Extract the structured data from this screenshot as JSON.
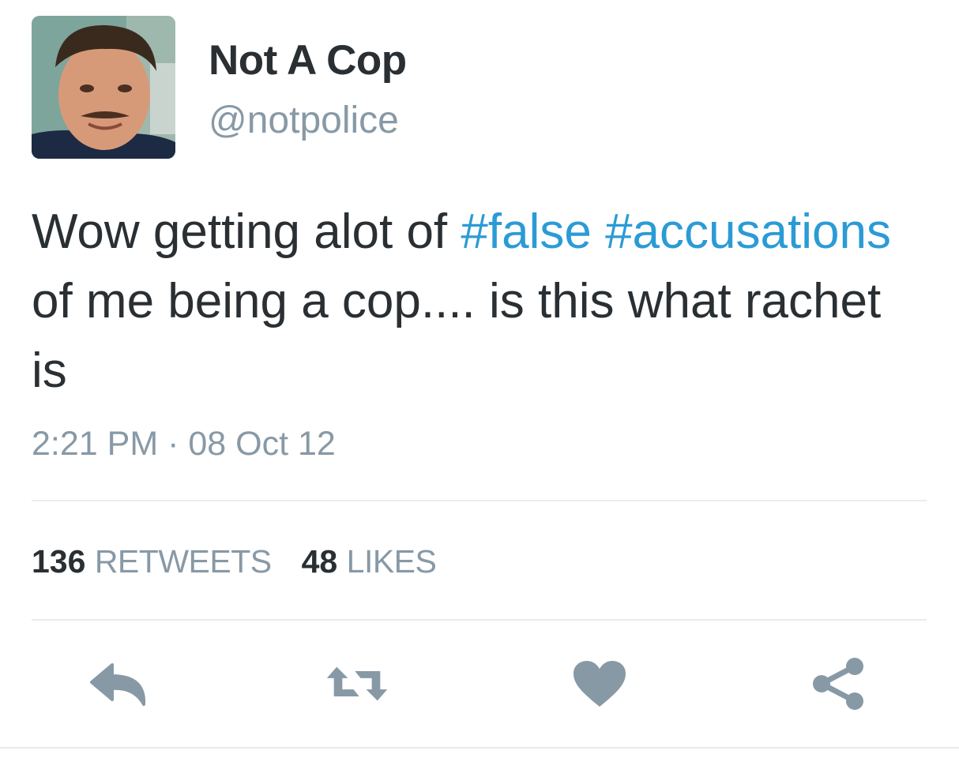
{
  "profile": {
    "display_name": "Not A Cop",
    "handle": "@notpolice"
  },
  "tweet": {
    "text_plain_1": "Wow getting alot of ",
    "hashtag_1": "#false",
    "hashtag_2": "#accusations",
    "text_plain_2": " of me being a cop.... is this what rachet is",
    "time": "2:21 PM",
    "separator": " · ",
    "date": "08 Oct 12"
  },
  "stats": {
    "retweets_count": "136",
    "retweets_label": "RETWEETS",
    "likes_count": "48",
    "likes_label": "LIKES"
  },
  "actions": {
    "reply_icon": "reply-icon",
    "retweet_icon": "retweet-icon",
    "like_icon": "heart-icon",
    "share_icon": "share-icon"
  },
  "colors": {
    "text": "#292f33",
    "muted": "#8899a6",
    "hashtag": "#2b9bd5",
    "icon": "#8899a6",
    "divider": "#e6ecf0"
  }
}
